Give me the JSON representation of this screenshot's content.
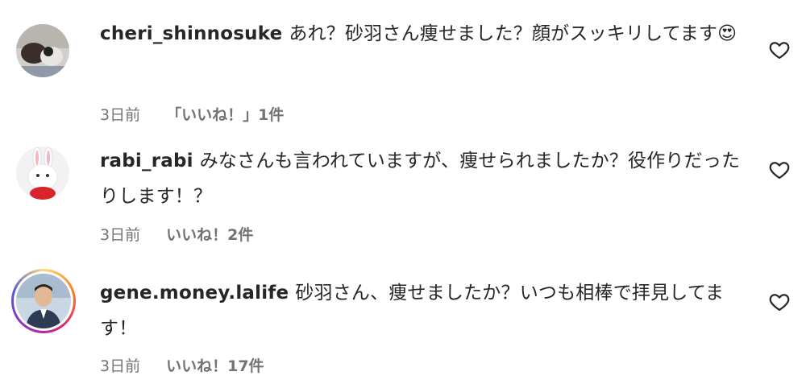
{
  "comments": [
    {
      "username": "cheri_shinnosuke",
      "text": "あれ？砂羽さん痩せました？顔がスッキリしてます",
      "emoji": "😍",
      "time": "3日前",
      "likes": "「いいね！」1件"
    },
    {
      "username": "rabi_rabi",
      "text": "みなさんも言われていますが、痩せられましたか？役作りだったりします！？",
      "emoji": "",
      "time": "3日前",
      "likes": "いいね！2件"
    },
    {
      "username": "gene.money.lalife",
      "text": "砂羽さん、痩せましたか？いつも相棒で拝見してます！",
      "emoji": "",
      "time": "3日前",
      "likes": "いいね！17件"
    }
  ],
  "icons": {
    "like": "heart-outline-icon"
  }
}
